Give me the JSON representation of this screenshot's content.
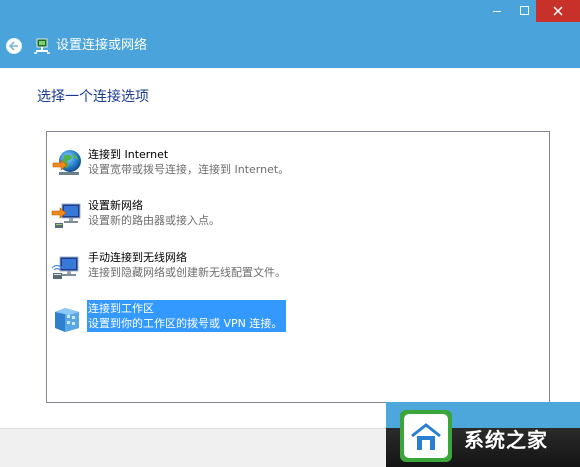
{
  "window": {
    "title": "设置连接或网络",
    "controls": {
      "minimize_icon": "minimize-icon",
      "maximize_icon": "maximize-icon",
      "close_icon": "close-icon"
    }
  },
  "nav": {
    "back_icon": "back-arrow-icon",
    "title": "设置连接或网络"
  },
  "content": {
    "heading": "选择一个连接选项",
    "options": [
      {
        "title": "连接到 Internet",
        "description": "设置宽带或拨号连接，连接到 Internet。",
        "icon": "globe-network-icon",
        "selected": false
      },
      {
        "title": "设置新网络",
        "description": "设置新的路由器或接入点。",
        "icon": "new-network-icon",
        "selected": false
      },
      {
        "title": "手动连接到无线网络",
        "description": "连接到隐藏网络或创建新无线配置文件。",
        "icon": "wireless-network-icon",
        "selected": false
      },
      {
        "title": "连接到工作区",
        "description": "设置到你的工作区的拨号或 VPN 连接。",
        "icon": "workplace-building-icon",
        "selected": true
      }
    ]
  },
  "watermark": {
    "text": "系统之家"
  },
  "colors": {
    "header": "#4aa3db",
    "heading_text": "#1a3a8f",
    "selection": "#3399ff",
    "close_button": "#c7312a"
  }
}
